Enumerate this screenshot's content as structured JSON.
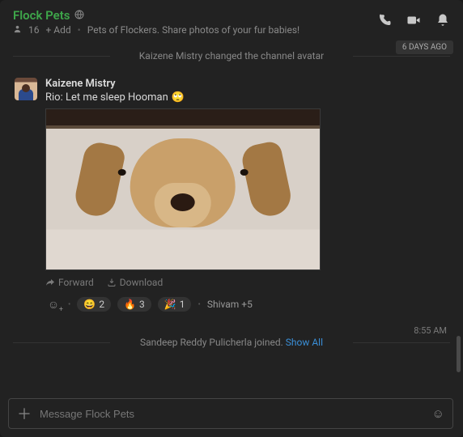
{
  "header": {
    "channel_name": "Flock Pets",
    "globe_icon": "globe-icon",
    "member_count": "16",
    "add_label": "+ Add",
    "topic": "Pets of Flockers. Share photos of your fur babies!",
    "actions": {
      "call": "phone-icon",
      "video": "video-icon",
      "notifications": "bell-icon"
    }
  },
  "days_badge": "6 DAYS AGO",
  "system_event_1": "Kaizene Mistry changed the channel avatar",
  "message": {
    "author": "Kaizene Mistry",
    "text": "Rio: Let me sleep Hooman",
    "emoji": "🙄",
    "attachment_alt": "dog-photo",
    "actions": {
      "forward": "Forward",
      "download": "Download"
    },
    "reactions": [
      {
        "emoji": "😄",
        "count": "2"
      },
      {
        "emoji": "🔥",
        "count": "3"
      },
      {
        "emoji": "🎉",
        "count": "1"
      }
    ],
    "reactors_summary": "Shivam +5",
    "timestamp": "8:55 AM"
  },
  "system_event_2": {
    "text": "Sandeep Reddy Pulicherla joined.",
    "show_all": "Show All"
  },
  "composer": {
    "placeholder": "Message Flock Pets"
  }
}
